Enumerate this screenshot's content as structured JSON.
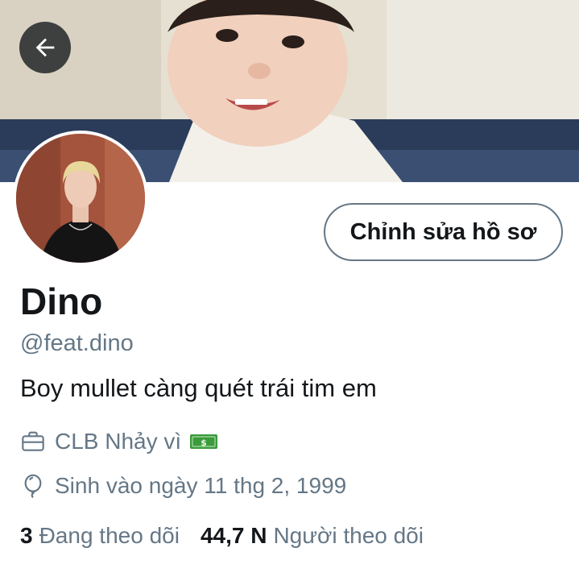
{
  "profile": {
    "name": "Dino",
    "handle": "@feat.dino",
    "bio": "Boy mullet càng quét trái tim em",
    "work": "CLB Nhảy vì",
    "birthday": "Sinh vào ngày 11 thg 2, 1999"
  },
  "actions": {
    "edit_profile_label": "Chỉnh sửa hồ sơ"
  },
  "stats": {
    "following_count": "3",
    "following_label": "Đang theo dõi",
    "followers_count": "44,7 N",
    "followers_label": "Người theo dõi"
  },
  "icons": {
    "back": "back-arrow-icon",
    "work": "briefcase-icon",
    "work_emoji": "money-banknote-icon",
    "birthday": "balloon-icon"
  },
  "colors": {
    "text_primary": "#14171a",
    "text_secondary": "#657786",
    "border": "#657786",
    "money_green": "#3c9a3c"
  }
}
